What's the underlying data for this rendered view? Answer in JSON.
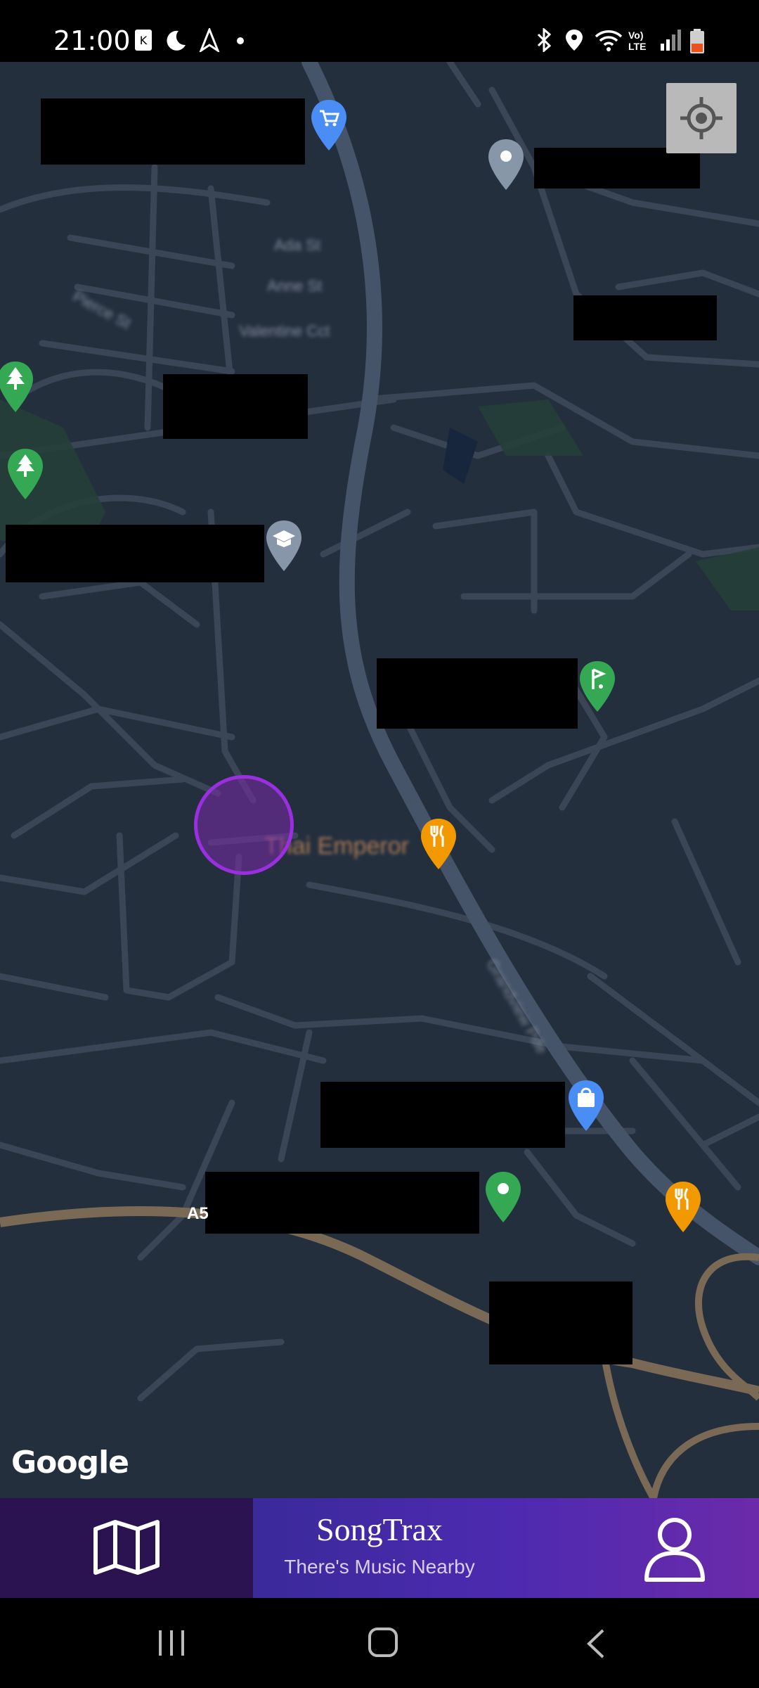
{
  "status_bar": {
    "time": "21:00",
    "left_icons": [
      "keyguard-icon",
      "do-not-disturb-moon-icon",
      "navigation-arrow-icon",
      "dot-icon"
    ],
    "right_icons": [
      "bluetooth-icon",
      "location-icon",
      "wifi-icon",
      "volte-icon",
      "signal-icon",
      "battery-low-icon"
    ],
    "volte_text": "Vo) LTE"
  },
  "map": {
    "attribution": "Google",
    "poi_label": "Thai Emperor",
    "road_label": "A5",
    "street_labels": [
      "Ada St",
      "Anne St",
      "Valentine Cct",
      "Pierce St",
      "Grandview Pde"
    ],
    "pins": [
      {
        "type": "shopping-cart",
        "color": "#4a8ef5"
      },
      {
        "type": "generic",
        "color": "#8796a8"
      },
      {
        "type": "park",
        "color": "#34a853"
      },
      {
        "type": "park",
        "color": "#34a853"
      },
      {
        "type": "school",
        "color": "#8796a8"
      },
      {
        "type": "golf",
        "color": "#34a853"
      },
      {
        "type": "restaurant",
        "color": "#f29900"
      },
      {
        "type": "shopping-bag",
        "color": "#4a8ef5"
      },
      {
        "type": "generic",
        "color": "#34a853"
      },
      {
        "type": "restaurant",
        "color": "#f29900"
      }
    ],
    "user_marker_color": "#9a2fe0"
  },
  "bottom_nav": {
    "map_icon": "map-icon",
    "title": "SongTrax",
    "subtitle": "There's Music Nearby",
    "profile_icon": "user-profile-icon"
  },
  "system_nav": [
    "recent-apps-icon",
    "home-icon",
    "back-icon"
  ]
}
